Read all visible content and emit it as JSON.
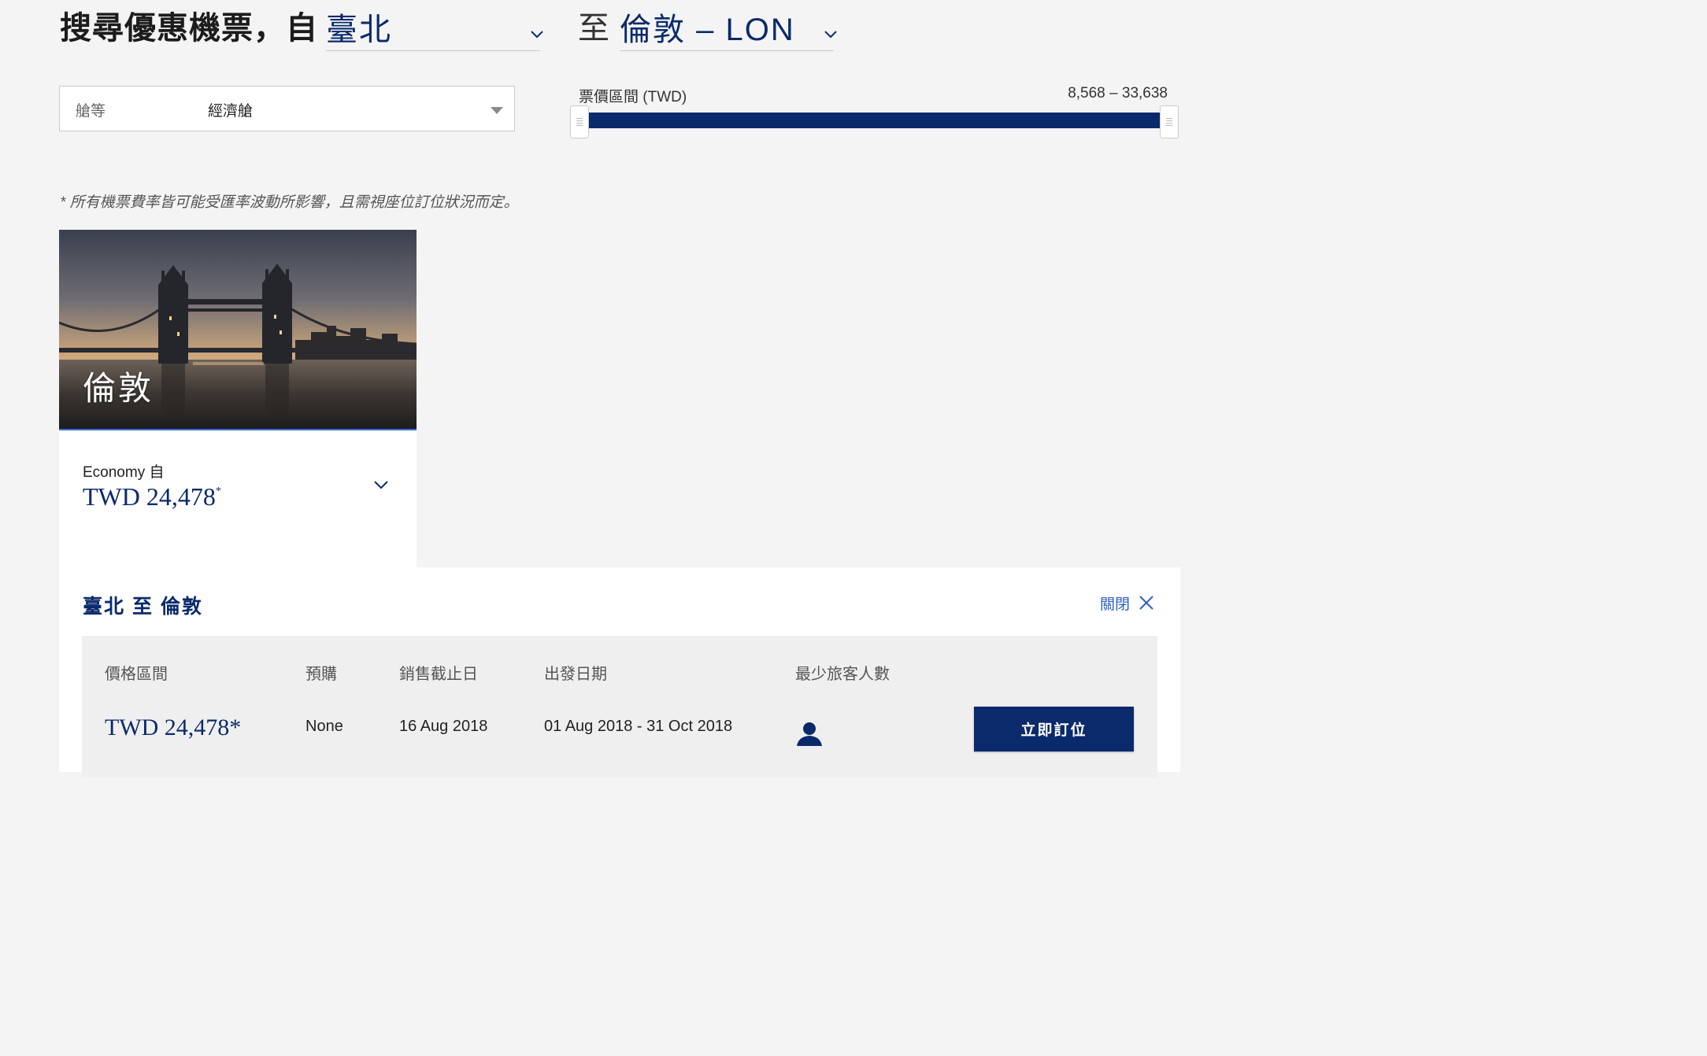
{
  "search": {
    "heading_prefix": "搜尋優惠機票，自",
    "from_value": "臺北",
    "to_word": "至",
    "to_value": "倫敦 – LON"
  },
  "filters": {
    "cabin_label": "艙等",
    "cabin_value": "經濟艙",
    "price_range_label": "票價區間 (TWD)",
    "price_range_values": "8,568 – 33,638",
    "range_min_fraction": 0,
    "range_max_fraction": 1
  },
  "disclaimer": "* 所有機票費率皆可能受匯率波動所影響，且需視座位訂位狀況而定。",
  "card": {
    "city": "倫敦",
    "economy_from": "Economy 自",
    "price": "TWD 24,478",
    "price_asterisk": "*"
  },
  "detail": {
    "title": "臺北 至 倫敦",
    "close_label": "關閉",
    "headers": [
      "價格區間",
      "預購",
      "銷售截止日",
      "出發日期",
      "最少旅客人數"
    ],
    "row": {
      "price": "TWD 24,478*",
      "advance_purchase": "None",
      "sale_end": "16 Aug 2018",
      "travel_dates": "01 Aug 2018 - 31 Oct 2018",
      "min_passengers_icon": "person-icon"
    },
    "book_label": "立即訂位"
  },
  "colors": {
    "brand_navy": "#0b2a6b",
    "link_blue": "#2d5fc4",
    "page_bg": "#f4f4f4"
  }
}
